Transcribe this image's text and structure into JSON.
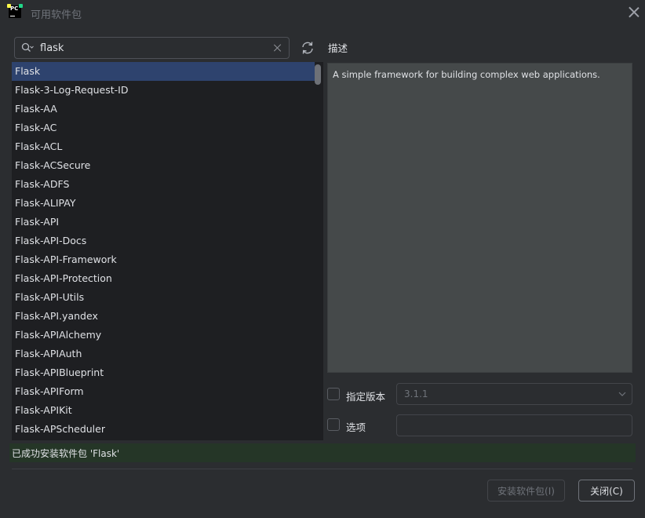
{
  "window": {
    "title": "可用软件包",
    "logo_text": "PC"
  },
  "search": {
    "value": "flask",
    "placeholder": ""
  },
  "packages": {
    "items": [
      "Flask",
      "Flask-3-Log-Request-ID",
      "Flask-AA",
      "Flask-AC",
      "Flask-ACL",
      "Flask-ACSecure",
      "Flask-ADFS",
      "Flask-ALIPAY",
      "Flask-API",
      "Flask-API-Docs",
      "Flask-API-Framework",
      "Flask-API-Protection",
      "Flask-API-Utils",
      "Flask-API.yandex",
      "Flask-APIAlchemy",
      "Flask-APIAuth",
      "Flask-APIBlueprint",
      "Flask-APIForm",
      "Flask-APIKit",
      "Flask-APScheduler"
    ],
    "selected_index": 0
  },
  "description": {
    "label": "描述",
    "text": "A simple framework for building complex web applications."
  },
  "version": {
    "checkbox_label": "指定版本",
    "checked": false,
    "value": "3.1.1"
  },
  "options": {
    "checkbox_label": "选项",
    "checked": false,
    "value": ""
  },
  "status": {
    "text": "已成功安装软件包 'Flask'"
  },
  "buttons": {
    "install_label": "安装软件包(I)",
    "close_label": "关闭(C)"
  },
  "colors": {
    "background": "#2b2d30",
    "list_background": "#1e1f22",
    "selection": "#2e436e",
    "status_background": "#253627",
    "description_background": "#45494a"
  },
  "icons": {
    "logo": "pycharm-logo-icon",
    "close": "close-icon",
    "search": "search-icon",
    "clear": "clear-icon",
    "refresh": "refresh-icon",
    "dropdown": "chevron-down-icon"
  }
}
